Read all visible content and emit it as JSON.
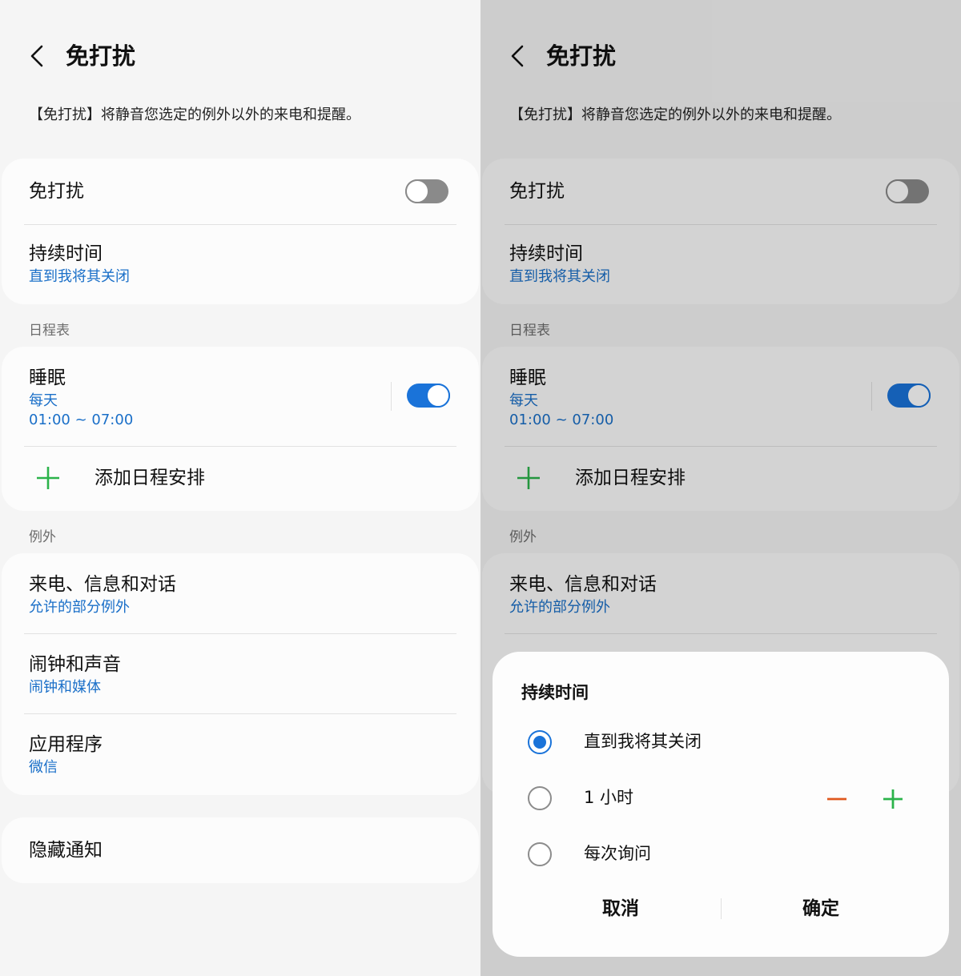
{
  "header": {
    "title": "免打扰"
  },
  "description": "【免打扰】将静音您选定的例外以外的来电和提醒。",
  "dnd": {
    "label": "免打扰",
    "enabled": false
  },
  "duration": {
    "label": "持续时间",
    "value": "直到我将其关闭"
  },
  "schedule": {
    "section_title": "日程表",
    "sleep": {
      "label": "睡眠",
      "days": "每天",
      "time": "01:00 ~ 07:00",
      "enabled": true
    },
    "add_label": "添加日程安排"
  },
  "exceptions": {
    "section_title": "例外",
    "calls": {
      "label": "来电、信息和对话",
      "value": "允许的部分例外"
    },
    "alarms": {
      "label": "闹钟和声音",
      "value": "闹钟和媒体"
    },
    "apps": {
      "label": "应用程序",
      "value": "微信"
    }
  },
  "hide_notifications": {
    "label": "隐藏通知"
  },
  "dialog": {
    "title": "持续时间",
    "options": [
      {
        "label": "直到我将其关闭",
        "checked": true
      },
      {
        "label": "1 小时",
        "checked": false
      },
      {
        "label": "每次询问",
        "checked": false
      }
    ],
    "cancel": "取消",
    "confirm": "确定"
  },
  "colors": {
    "accent": "#1a73d9",
    "link": "#1a6fc8",
    "add_icon": "#2bb34a",
    "minus_icon": "#e0581e"
  }
}
